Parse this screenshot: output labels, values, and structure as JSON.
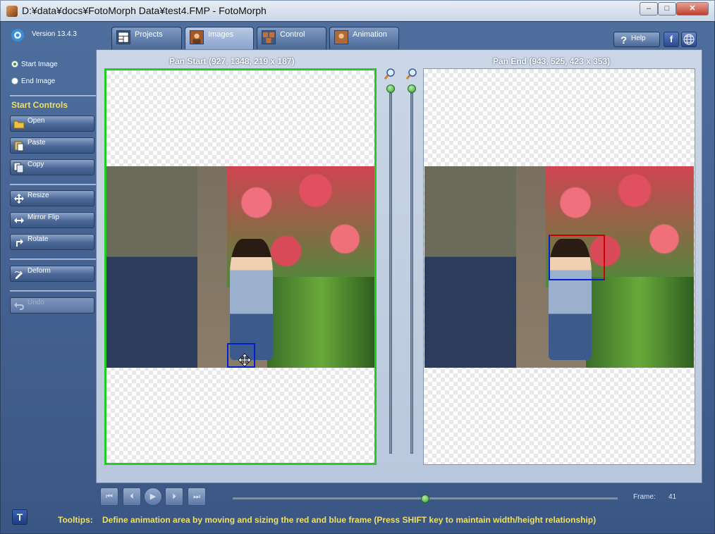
{
  "window": {
    "title": "D:¥data¥docs¥FotoMorph Data¥test4.FMP - FotoMorph",
    "minimize": "‒",
    "maximize": "□",
    "close": "✕"
  },
  "sidebar": {
    "version": "Version 13.4.3",
    "radio_start": "Start Image",
    "radio_end": "End Image",
    "section_title": "Start Controls",
    "buttons": {
      "open": "Open",
      "paste": "Paste",
      "copy": "Copy",
      "resize": "Resize",
      "mirror": "Mirror Flip",
      "rotate": "Rotate",
      "deform": "Deform",
      "undo": "Undo"
    }
  },
  "tabs": {
    "projects": "Projects",
    "images": "Images",
    "control": "Control",
    "animation": "Animation"
  },
  "header_right": {
    "help": "Help",
    "facebook": "f"
  },
  "panes": {
    "start_title": "Pan Start (927, 1348, 219 x 187)",
    "end_title": "Pan End (943, 525, 423 x 353)"
  },
  "playback": {
    "first": "⏮",
    "prev": "⏴",
    "play": "▶",
    "next": "⏵",
    "last": "⏭",
    "frame_label": "Frame:",
    "frame_value": "41",
    "position": 0.5
  },
  "footer": {
    "tooltips_label": "Tooltips:",
    "tooltips_text": "Define animation area by moving and sizing the red and blue frame (Press SHIFT key to maintain width/height relationship)",
    "t_button": "T"
  },
  "colors": {
    "accent_green": "#22cc22",
    "start_frame_blue": "#0022cc",
    "end_frame_red": "#cc0000",
    "tooltip_yellow": "#f0e060"
  }
}
